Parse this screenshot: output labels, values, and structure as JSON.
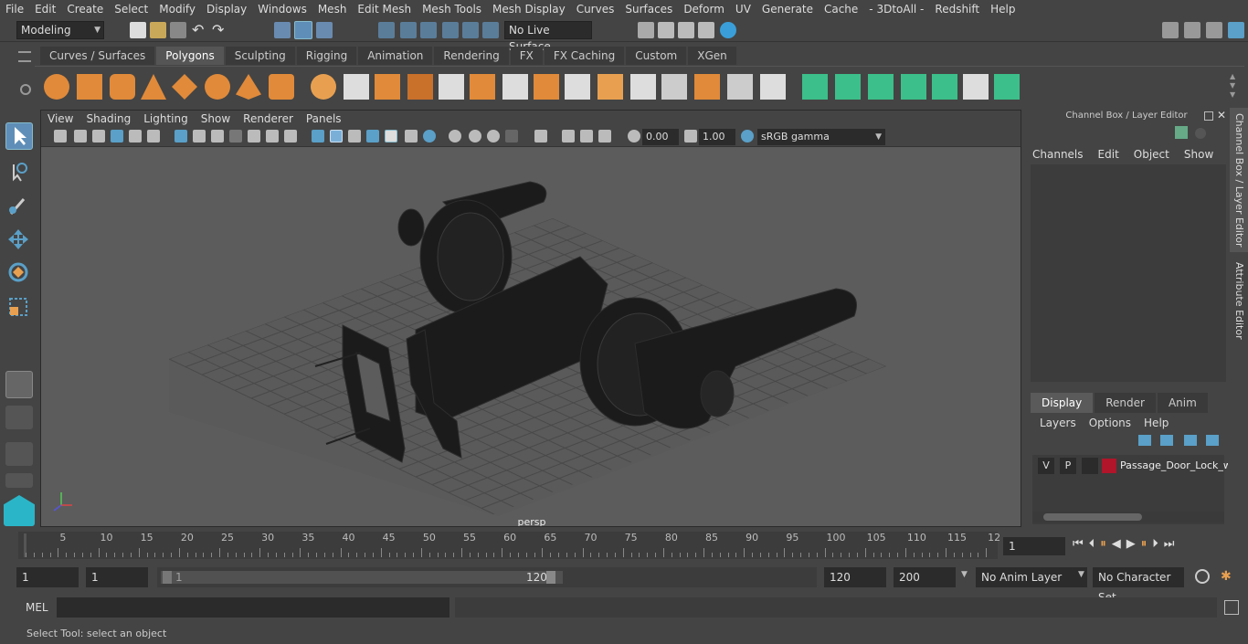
{
  "menu": [
    "File",
    "Edit",
    "Create",
    "Select",
    "Modify",
    "Display",
    "Windows",
    "Mesh",
    "Edit Mesh",
    "Mesh Tools",
    "Mesh Display",
    "Curves",
    "Surfaces",
    "Deform",
    "UV",
    "Generate",
    "Cache",
    "- 3DtoAll -",
    "Redshift",
    "Help"
  ],
  "status": {
    "mode": "Modeling",
    "live_surface": "No Live Surface"
  },
  "shelf_tabs": [
    "Curves / Surfaces",
    "Polygons",
    "Sculpting",
    "Rigging",
    "Animation",
    "Rendering",
    "FX",
    "FX Caching",
    "Custom",
    "XGen"
  ],
  "active_shelf_tab": "Polygons",
  "viewport": {
    "menu": [
      "View",
      "Shading",
      "Lighting",
      "Show",
      "Renderer",
      "Panels"
    ],
    "exposure": "0.00",
    "gamma": "1.00",
    "color_space": "sRGB gamma",
    "camera_label": "persp"
  },
  "channel_box": {
    "title": "Channel Box / Layer Editor",
    "menu": [
      "Channels",
      "Edit",
      "Object",
      "Show"
    ],
    "tabs": [
      "Display",
      "Render",
      "Anim"
    ],
    "active_tab": "Display",
    "layer_menu": [
      "Layers",
      "Options",
      "Help"
    ],
    "layer": {
      "v": "V",
      "p": "P",
      "name": "Passage_Door_Lock_w",
      "color": "#b0152a"
    }
  },
  "side_tabs": [
    "Channel Box / Layer Editor",
    "Attribute Editor"
  ],
  "timeline": {
    "ticks": [
      "5",
      "10",
      "15",
      "20",
      "25",
      "30",
      "35",
      "40",
      "45",
      "50",
      "55",
      "60",
      "65",
      "70",
      "75",
      "80",
      "85",
      "90",
      "95",
      "100",
      "105",
      "110",
      "115",
      "12"
    ],
    "start_label": "1",
    "current_frame": "1"
  },
  "range": {
    "start": "1",
    "playback_start": "1",
    "slider_start": "1",
    "slider_end": "120",
    "playback_end": "120",
    "end": "200",
    "anim_layer": "No Anim Layer",
    "character_set": "No Character Set"
  },
  "command": {
    "label": "MEL"
  },
  "help_line": "Select Tool: select an object"
}
